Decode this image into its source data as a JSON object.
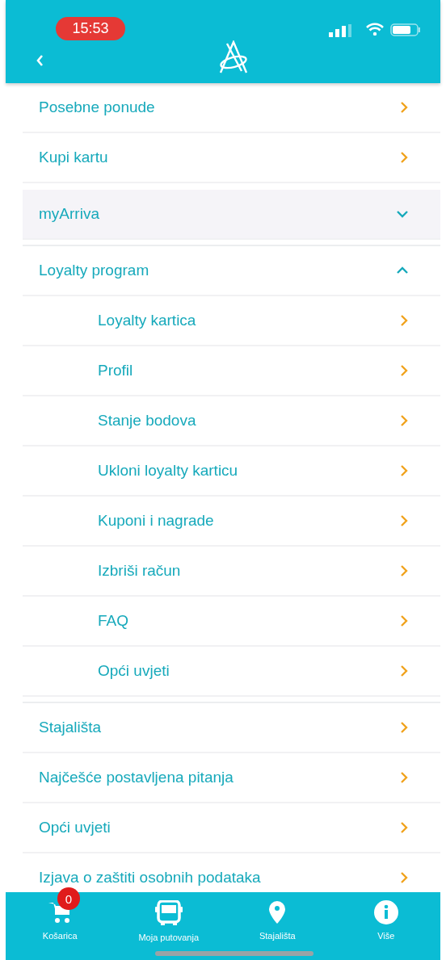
{
  "status_bar": {
    "time": "15:53"
  },
  "menu": [
    {
      "label": "Posebne ponude",
      "kind": "link"
    },
    {
      "label": "Kupi kartu",
      "kind": "link"
    },
    {
      "label": "myArriva",
      "kind": "group",
      "expanded": false
    },
    {
      "label": "Loyalty program",
      "kind": "group",
      "expanded": true,
      "children": [
        {
          "label": "Loyalty kartica"
        },
        {
          "label": "Profil"
        },
        {
          "label": "Stanje bodova"
        },
        {
          "label": "Ukloni loyalty karticu"
        },
        {
          "label": "Kuponi i nagrade"
        },
        {
          "label": "Izbriši račun"
        },
        {
          "label": "FAQ"
        },
        {
          "label": "Opći uvjeti"
        }
      ]
    },
    {
      "label": "Stajališta",
      "kind": "link"
    },
    {
      "label": "Najčešće postavljena pitanja",
      "kind": "link"
    },
    {
      "label": "Opći uvjeti",
      "kind": "link"
    },
    {
      "label": "Izjava o zaštiti osobnih podataka",
      "kind": "link"
    }
  ],
  "tab_bar": [
    {
      "label": "Košarica",
      "kind": "cart",
      "badge": "0"
    },
    {
      "label": "Moja putovanja",
      "kind": "bus"
    },
    {
      "label": "Stajališta",
      "kind": "pin"
    },
    {
      "label": "Više",
      "kind": "info"
    }
  ]
}
